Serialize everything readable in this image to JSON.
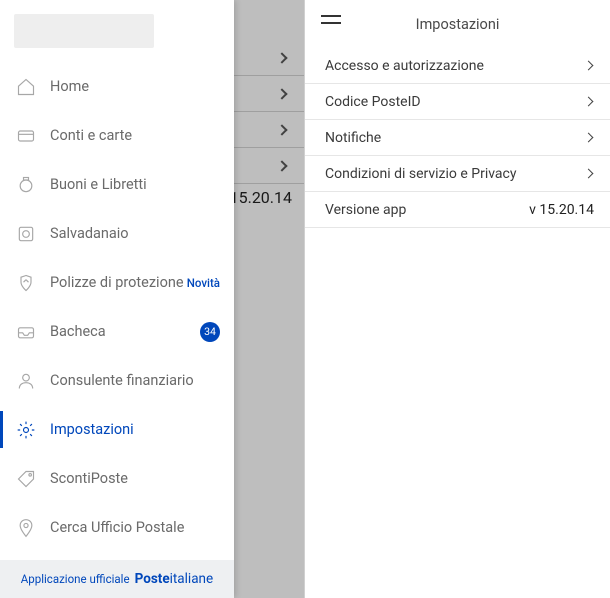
{
  "left": {
    "bg_version": "15.20.14",
    "menu": [
      {
        "icon": "home",
        "label": "Home",
        "active": false
      },
      {
        "icon": "card",
        "label": "Conti e carte",
        "active": false
      },
      {
        "icon": "jar",
        "label": "Buoni e Libretti",
        "active": false
      },
      {
        "icon": "piggy",
        "label": "Salvadanaio",
        "active": false
      },
      {
        "icon": "shield",
        "label": "Polizze di protezione",
        "active": false,
        "tag": "Novità"
      },
      {
        "icon": "inbox",
        "label": "Bacheca",
        "active": false,
        "badge": "34"
      },
      {
        "icon": "person",
        "label": "Consulente finanziario",
        "active": false
      },
      {
        "icon": "gear",
        "label": "Impostazioni",
        "active": true
      },
      {
        "icon": "tag",
        "label": "ScontiPoste",
        "active": false
      },
      {
        "icon": "pin",
        "label": "Cerca Ufficio Postale",
        "active": false
      }
    ],
    "footer_pre": "Applicazione ufficiale",
    "footer_brand_bold": "Poste",
    "footer_brand_light": "italiane"
  },
  "right": {
    "title": "Impostazioni",
    "rows": [
      {
        "label": "Accesso e autorizzazione",
        "chevron": true
      },
      {
        "label": "Codice PosteID",
        "chevron": true
      },
      {
        "label": "Notifiche",
        "chevron": true
      },
      {
        "label": "Condizioni di servizio e Privacy",
        "chevron": true
      },
      {
        "label": "Versione app",
        "value": "v 15.20.14"
      }
    ]
  }
}
